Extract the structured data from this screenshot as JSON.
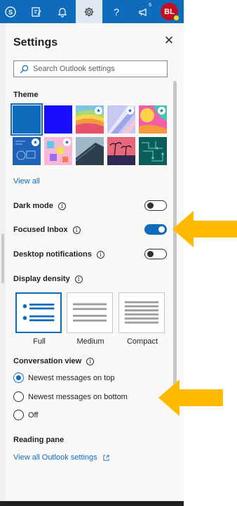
{
  "topbar": {
    "icons": [
      "skype-icon",
      "my-day-icon",
      "bell-icon",
      "gear-icon",
      "help-icon",
      "megaphone-icon"
    ],
    "whats_new_count": "6",
    "avatar_initials": "BL"
  },
  "settings": {
    "title": "Settings",
    "search_placeholder": "Search Outlook settings",
    "theme_heading": "Theme",
    "themes": [
      {
        "name": "Blue",
        "selected": true,
        "star": false
      },
      {
        "name": "Violet",
        "selected": false,
        "star": false
      },
      {
        "name": "Rainbow waves",
        "selected": false,
        "star": true
      },
      {
        "name": "Pastel light",
        "selected": false,
        "star": true
      },
      {
        "name": "Palm pink",
        "selected": false,
        "star": true
      },
      {
        "name": "Blueprint",
        "selected": false,
        "star": true
      },
      {
        "name": "Cubes",
        "selected": false,
        "star": true
      },
      {
        "name": "Rooftop",
        "selected": false,
        "star": false
      },
      {
        "name": "Palm sunset",
        "selected": false,
        "star": false
      },
      {
        "name": "Circuit",
        "selected": false,
        "star": false
      }
    ],
    "view_all": "View all",
    "dark_mode": {
      "label": "Dark mode",
      "on": false
    },
    "focused_inbox": {
      "label": "Focused Inbox",
      "on": true
    },
    "desktop_notifications": {
      "label": "Desktop notifications",
      "on": false
    },
    "display_density": {
      "heading": "Display density",
      "options": [
        "Full",
        "Medium",
        "Compact"
      ],
      "selected": "Full"
    },
    "conversation_view": {
      "heading": "Conversation view",
      "options": [
        "Newest messages on top",
        "Newest messages on bottom",
        "Off"
      ],
      "selected": "Newest messages on top"
    },
    "reading_pane": "Reading pane",
    "view_all_settings": "View all Outlook settings"
  },
  "colors": {
    "accent": "#0f6cbd",
    "annotation_arrow": "#ffb900"
  }
}
